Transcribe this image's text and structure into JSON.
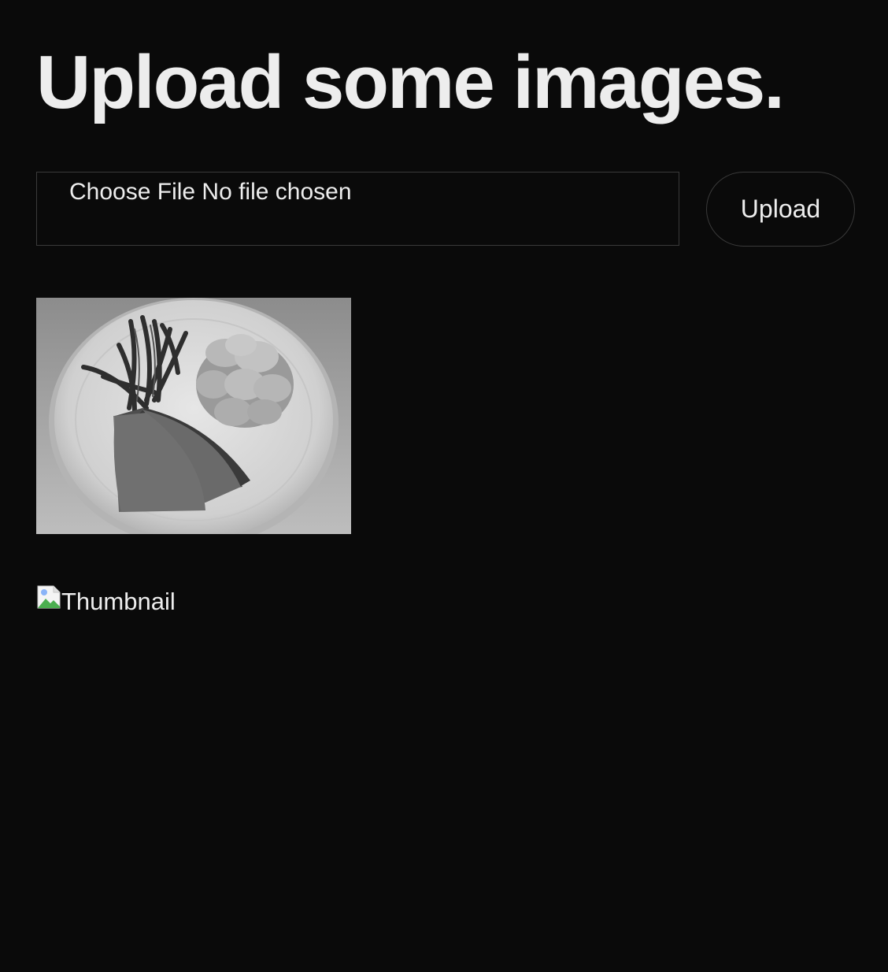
{
  "page": {
    "title": "Upload some images."
  },
  "upload_form": {
    "file_input_text": "Choose File No file chosen",
    "upload_button_label": "Upload"
  },
  "gallery": {
    "images": [
      {
        "type": "photo",
        "subject": "plate-of-food-grayscale"
      },
      {
        "type": "broken-image",
        "alt": "Thumbnail"
      }
    ]
  },
  "colors": {
    "background": "#0a0a0a",
    "text": "#ededed",
    "border": "#3a3a3a"
  }
}
